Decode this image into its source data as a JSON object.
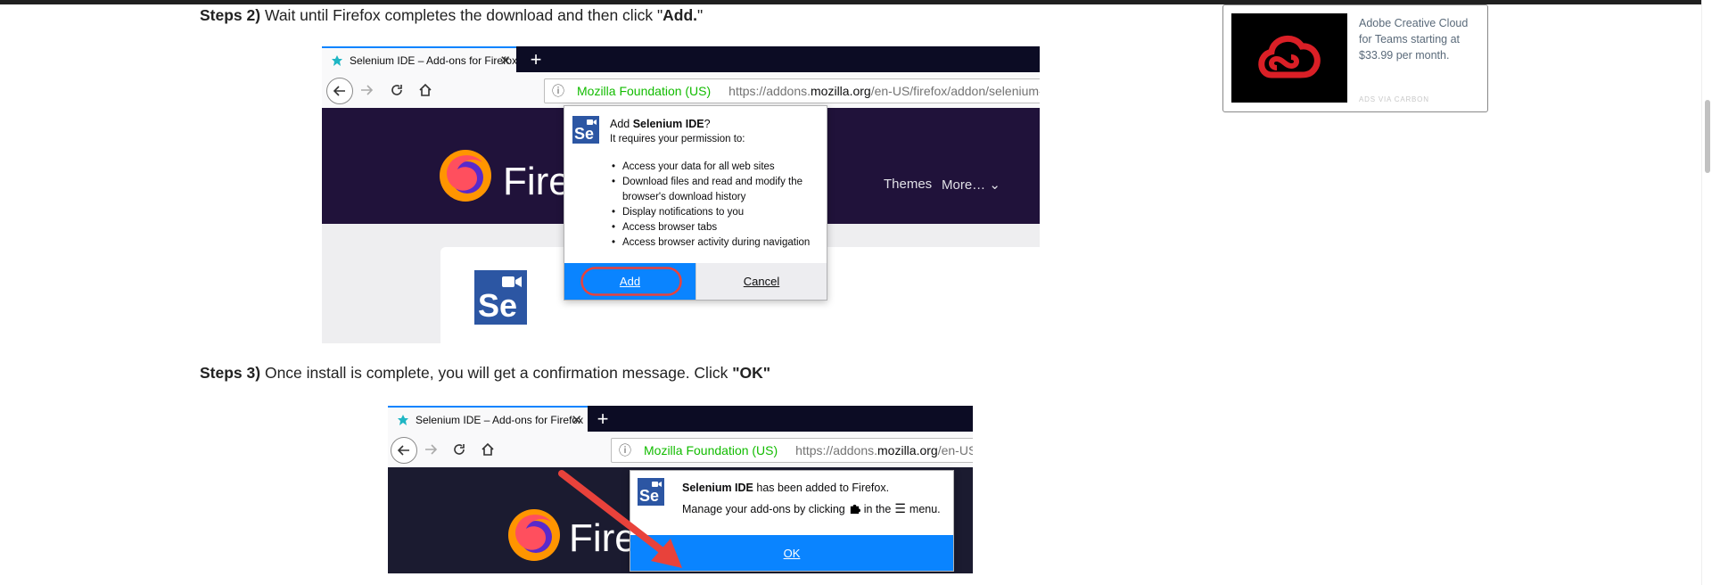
{
  "step2": {
    "label": "Steps 2)",
    "text": "Wait until Firefox completes the download and then click \"",
    "bold": "Add.",
    "close": "\""
  },
  "step3": {
    "label": "Steps 3)",
    "text": "Once install is complete, you will get a confirmation message. Click ",
    "bold": "\"OK\""
  },
  "shot1": {
    "tab_title": "Selenium IDE – Add-ons for Firefox",
    "new_tab": "+",
    "identity": "Mozilla Foundation (US)",
    "url_prefix": "https://addons.",
    "url_domain": "mozilla.org",
    "url_suffix": "/en-US/firefox/addon/selenium-ide/",
    "brand": "Firefox",
    "nav_themes": "Themes",
    "nav_more": "More…",
    "popup": {
      "prefix": "Add ",
      "name": "Selenium IDE",
      "suffix": "?",
      "subtitle": "It requires your permission to:",
      "permissions": [
        "Access your data for all web sites",
        "Download files and read and modify the browser's download history",
        "Display notifications to you",
        "Access browser tabs",
        "Access browser activity during navigation"
      ],
      "add_label": "Add",
      "cancel_label": "Cancel"
    },
    "se_logo": "Se"
  },
  "shot2": {
    "tab_title": "Selenium IDE – Add-ons for Firefox",
    "new_tab": "+",
    "identity": "Mozilla Foundation (US)",
    "url_prefix": "https://addons.",
    "url_domain": "mozilla.org",
    "url_suffix": "/en-US/firefox/",
    "brand": "Firefox",
    "popup": {
      "name": "Selenium IDE",
      "added_text": " has been added to Firefox.",
      "manage_prefix": "Manage your add-ons by clicking",
      "manage_middle": "in the",
      "manage_suffix": "menu.",
      "ok_label": "OK"
    },
    "se_logo": "Se"
  },
  "ad": {
    "text": "Adobe Creative Cloud for Teams starting at $33.99 per month.",
    "via": "ADS VIA CARBON"
  },
  "colors": {
    "accent_blue": "#0a84ff",
    "secure_green": "#12bc00",
    "highlight_red": "#e8423b",
    "tabstrip": "#0c0c24",
    "selenium_blue": "#2c56a3",
    "adobe_red": "#da1f26"
  },
  "icons": {
    "back": "back-arrow-icon",
    "forward": "forward-arrow-icon",
    "reload": "reload-icon",
    "home": "home-icon",
    "info": "info-icon",
    "puzzle": "puzzle-piece-icon",
    "lock": "lock-icon",
    "close": "close-icon",
    "menu": "hamburger-menu-icon"
  }
}
